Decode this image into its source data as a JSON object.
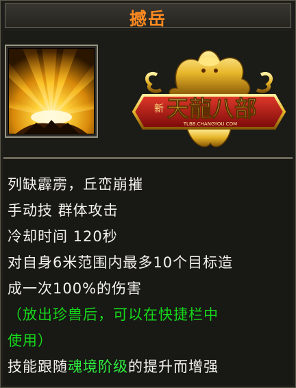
{
  "skill": {
    "name": "撼岳",
    "icon": "golden-burst-skill-icon"
  },
  "logo": {
    "name_prefix": "新",
    "name": "天龍八部",
    "website": "TLBB.CHANGYOU.COM",
    "emblem": "golden-dragon-icon"
  },
  "description": {
    "line1": "列缺霹雳，丘峦崩摧",
    "line2": "手动技  群体攻击",
    "line3": "冷却时间  120秒",
    "line4": "对自身6米范围内最多10个目标造",
    "line5": "成一次100%的伤害",
    "line6": "（放出珍兽后，可以在快捷栏中",
    "line7": "使用）",
    "line8_before": "技能跟随",
    "line8_highlight": "魂境阶级",
    "line8_after": "的提升而增强"
  },
  "colors": {
    "title": "#ff8a20",
    "text": "#f4f2ec",
    "hint": "#16d91a",
    "highlight": "#2ef040",
    "banner_red": "#b01818",
    "gold": "#e8b62a"
  }
}
